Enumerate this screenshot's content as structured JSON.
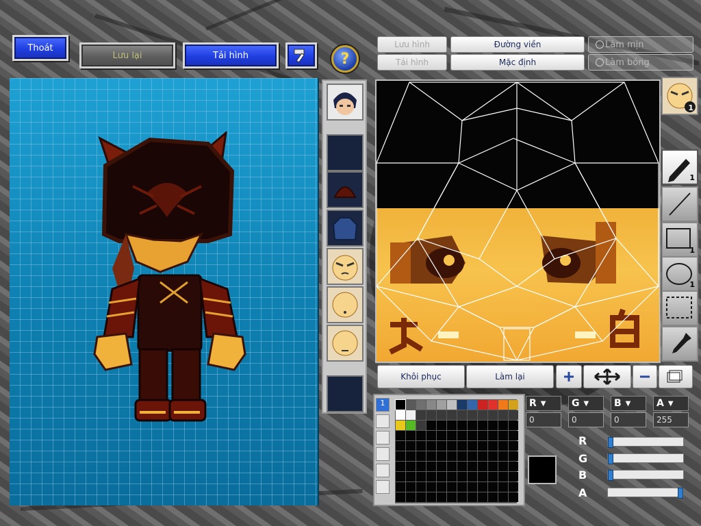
{
  "toolbar": {
    "exit_label": "Thoát",
    "save_label": "Lưu lại",
    "load_label": "Tải hình",
    "help_symbol": "?"
  },
  "editor_tabs": {
    "save_image": "Lưu hình",
    "load_image": "Tải hình",
    "outline": "Đường viền",
    "default": "Mặc định",
    "smooth": "Làm mịn",
    "gloss": "Làm bóng"
  },
  "part_slots": [
    {
      "name": "hair-slot"
    },
    {
      "name": "empty-slot-1"
    },
    {
      "name": "hat-slot"
    },
    {
      "name": "armor-slot"
    },
    {
      "name": "face-slot-1"
    },
    {
      "name": "face-slot-2"
    },
    {
      "name": "face-slot-3"
    },
    {
      "name": "empty-slot-2"
    }
  ],
  "tools": {
    "face_badge": "1",
    "pen_count": "1",
    "rect_count": "1",
    "ellipse_count": "1",
    "icons": [
      "pencil-icon",
      "line-icon",
      "rectangle-icon",
      "ellipse-icon",
      "selection-icon",
      "eyedropper-icon"
    ]
  },
  "actions": {
    "restore": "Khôi phục",
    "redo": "Làm lại"
  },
  "color": {
    "r_label": "R",
    "g_label": "G",
    "b_label": "B",
    "a_label": "A",
    "r_value": "0",
    "g_value": "0",
    "b_value": "0",
    "a_value": "255",
    "preview_hex": "#000000",
    "sliders": {
      "r": 0,
      "g": 0,
      "b": 0,
      "a": 255
    }
  },
  "palette": {
    "tab_indicator": "1",
    "swatches": [
      "#000000",
      "#5a5a5a",
      "#707070",
      "#888888",
      "#a0a0a0",
      "#c0c0c0",
      "#1a3a6a",
      "#3366aa",
      "#cc2222",
      "#e0322a",
      "#f07a1a",
      "#d4a21a",
      "#ffffff",
      "#f0f0f0",
      "#3a3a3a",
      "#3a3a3a",
      "#3a3a3a",
      "#3a3a3a",
      "#3a3a3a",
      "#3a3a3a",
      "#3a3a3a",
      "#3a3a3a",
      "#3a3a3a",
      "#3a3a3a",
      "#e8c81a",
      "#55bb22",
      "#3a3a3a",
      "#050505",
      "#050505",
      "#050505",
      "#050505",
      "#050505",
      "#050505",
      "#050505",
      "#050505",
      "#050505"
    ]
  },
  "colors": {
    "accent_blue": "#1f3fe0",
    "canvas_blue": "#0d7fb0",
    "texture_gold": "#f7c34d"
  }
}
